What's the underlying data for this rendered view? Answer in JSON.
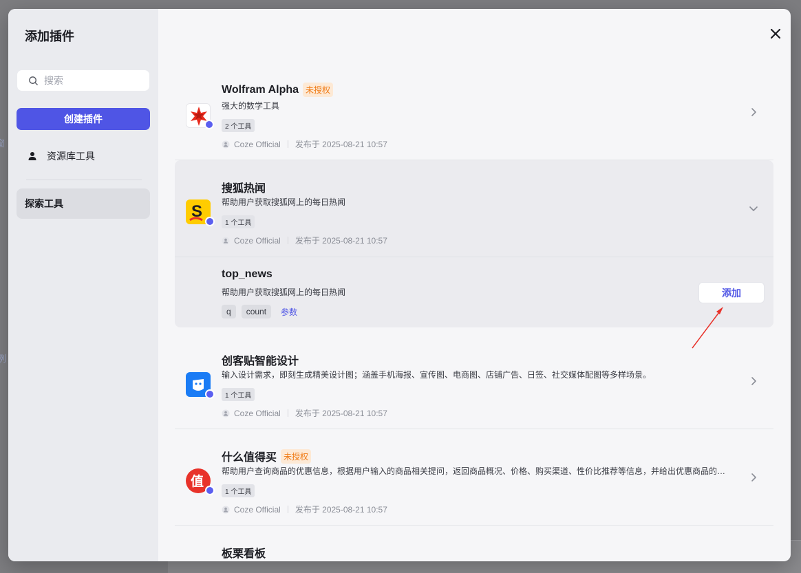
{
  "modal": {
    "title": "添加插件",
    "close_icon": "close-icon"
  },
  "sidebar": {
    "search_placeholder": "搜索",
    "create_label": "创建插件",
    "library_label": "资源库工具",
    "explore_label": "探索工具"
  },
  "plugins": [
    {
      "name": "Wolfram Alpha",
      "badge": "未授权",
      "desc": "强大的数学工具",
      "tools": "2 个工具",
      "publisher": "Coze Official",
      "published": "发布于 2025-08-21 10:57"
    },
    {
      "name": "搜狐热闻",
      "desc": "帮助用户获取搜狐网上的每日热闻",
      "tools": "1 个工具",
      "publisher": "Coze Official",
      "published": "发布于 2025-08-21 10:57"
    },
    {
      "name": "创客贴智能设计",
      "desc": "输入设计需求，即刻生成精美设计图；涵盖手机海报、宣传图、电商图、店铺广告、日签、社交媒体配图等多样场景。",
      "tools": "1 个工具",
      "publisher": "Coze Official",
      "published": "发布于 2025-08-21 10:57"
    },
    {
      "name": "什么值得买",
      "badge": "未授权",
      "desc": "帮助用户查询商品的优惠信息，根据用户输入的商品相关提问，返回商品概况、价格、购买渠道、性价比推荐等信息，并给出优惠商品的…",
      "tools": "1 个工具",
      "publisher": "Coze Official",
      "published": "发布于 2025-08-21 10:57"
    },
    {
      "name": "板栗看板"
    }
  ],
  "tool": {
    "name": "top_news",
    "desc": "帮助用户获取搜狐网上的每日热闻",
    "params": [
      "q",
      "count"
    ],
    "params_label": "参数",
    "add_label": "添加"
  },
  "background": {
    "hint1": "窗",
    "hint2": "例"
  },
  "colors": {
    "accent": "#4f55e5",
    "unauth_bg": "#fde9d5",
    "unauth_text": "#f07b16",
    "arrow": "#e8322a"
  }
}
